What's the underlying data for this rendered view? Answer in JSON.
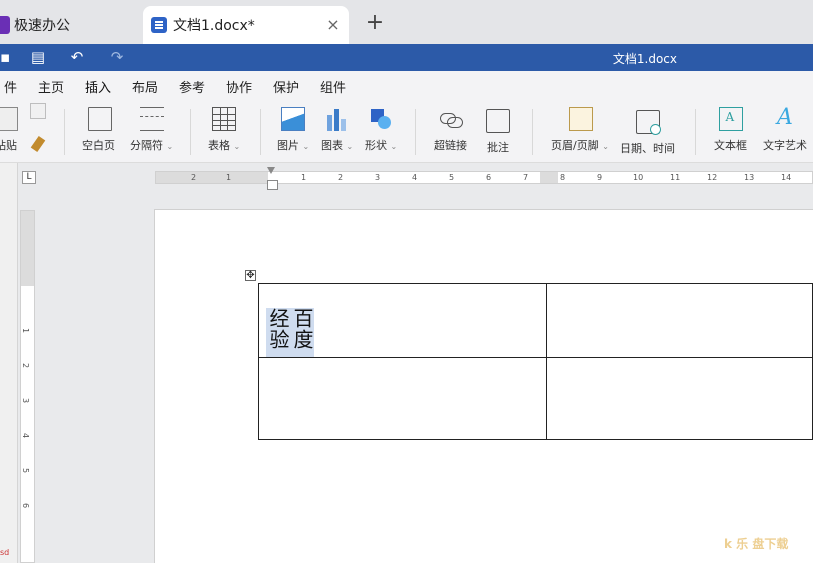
{
  "tabs": {
    "inactive_tab": "极速办公",
    "active_tab": "文档1.docx*",
    "close_symbol": "×",
    "add_symbol": "+"
  },
  "titlebar": {
    "title": "文档1.docx"
  },
  "menu": [
    {
      "label": "件"
    },
    {
      "label": "主页"
    },
    {
      "label": "插入"
    },
    {
      "label": "布局"
    },
    {
      "label": "参考"
    },
    {
      "label": "协作"
    },
    {
      "label": "保护"
    },
    {
      "label": "组件"
    }
  ],
  "ribbon": {
    "paste": "粘贴",
    "blank_page": "空白页",
    "separator": "分隔符",
    "table": "表格",
    "picture": "图片",
    "chart": "图表",
    "shape": "形状",
    "hyperlink": "超链接",
    "comment": "批注",
    "header_footer": "页眉/页脚",
    "date_time": "日期、时间",
    "text_box": "文本框",
    "word_art": "文字艺术",
    "dropdown_symbol": "⌄"
  },
  "ruler": {
    "corner": "L",
    "h_ticks": [
      "2",
      "1",
      "1",
      "2",
      "3",
      "4",
      "5",
      "6",
      "7",
      "8",
      "9",
      "10",
      "11",
      "12",
      "13",
      "14"
    ],
    "v_ticks": [
      "1",
      "2",
      "3",
      "4",
      "5",
      "6"
    ]
  },
  "document": {
    "cell_text": "百度经验",
    "move_handle": "✥",
    "watermark": "k 乐 盘下载",
    "left_mark": "sd"
  },
  "colors": {
    "title_bar": "#2c5aa8",
    "selection": "#cfdcef"
  }
}
